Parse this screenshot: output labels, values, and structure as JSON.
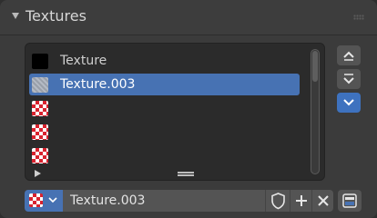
{
  "panel": {
    "title": "Textures",
    "collapse_icon": "triangle-down-icon",
    "grip_icon": "drag-grip-icon"
  },
  "list": {
    "items": [
      {
        "label": "Texture",
        "icon": "black-square-icon",
        "selected": false
      },
      {
        "label": "Texture.003",
        "icon": "noise-texture-icon",
        "selected": true
      },
      {
        "label": "",
        "icon": "checker-texture-icon",
        "selected": false
      },
      {
        "label": "",
        "icon": "checker-texture-icon",
        "selected": false
      },
      {
        "label": "",
        "icon": "checker-texture-icon",
        "selected": false
      }
    ],
    "expand_icon": "triangle-right-icon",
    "resize_icon": "resize-handle-icon"
  },
  "side_buttons": [
    {
      "name": "move-up-button",
      "icon": "chevron-up-icon"
    },
    {
      "name": "move-down-button",
      "icon": "chevron-down-icon"
    },
    {
      "name": "specials-menu-button",
      "icon": "chevron-down-icon"
    }
  ],
  "bottom_bar": {
    "browse_icon": "checker-texture-icon",
    "datablock_name": "Texture.003",
    "fake_user_icon": "shield-icon",
    "new_icon": "plus-icon",
    "unlink_icon": "x-icon",
    "node_icon": "texture-node-icon"
  },
  "colors": {
    "accent": "#4772b3",
    "panel_bg": "#3b3b3b",
    "list_bg": "#2b2b2b",
    "button_bg": "#545454",
    "checker_red": "#d9232f"
  }
}
